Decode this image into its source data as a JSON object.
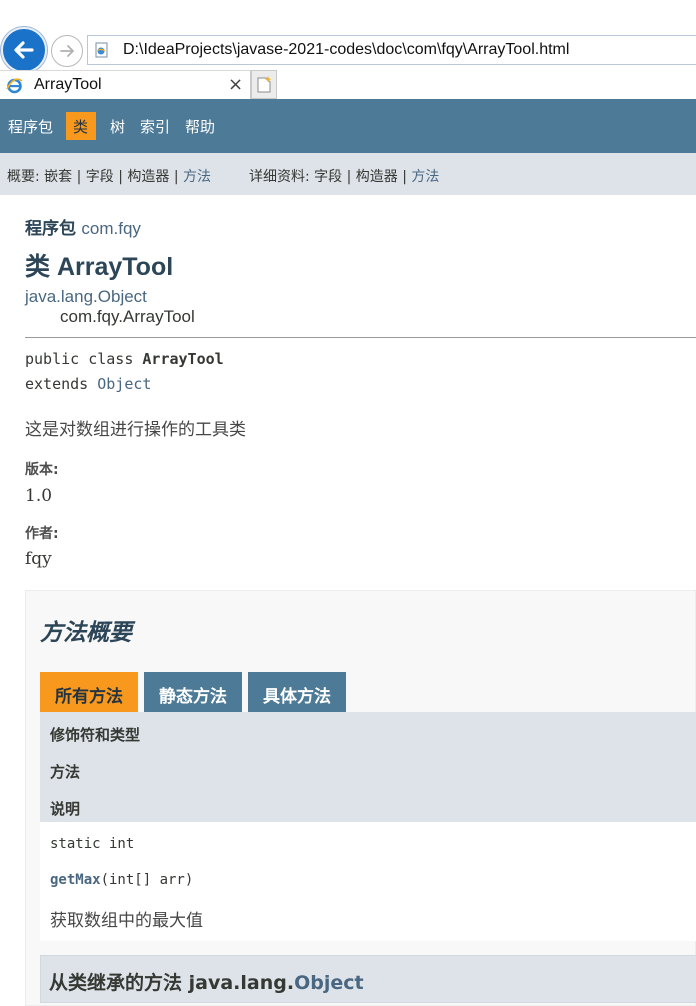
{
  "browser": {
    "address": "D:\\IdeaProjects\\javase-2021-codes\\doc\\com\\fqy\\ArrayTool.html",
    "tab_title": "ArrayTool",
    "tab_close": "×"
  },
  "top_nav": {
    "items": [
      "程序包",
      "类",
      "树",
      "索引",
      "帮助"
    ],
    "current": "类"
  },
  "sub_nav": {
    "summary_prefix": "概要: 嵌套 | 字段 | 构造器 | ",
    "summary_link": "方法",
    "detail_prefix": "详细资料: 字段 | 构造器 | ",
    "detail_link": "方法"
  },
  "header": {
    "package_label": "程序包",
    "package_name": "com.fqy",
    "class_title": "类 ArrayTool",
    "inherit_parent": "java.lang.Object",
    "inherit_child": "com.fqy.ArrayTool"
  },
  "signature": {
    "line1_prefix": "public class ",
    "line1_name": "ArrayTool",
    "line2_prefix": "extends ",
    "line2_link": "Object"
  },
  "description": "这是对数组进行操作的工具类",
  "tags": {
    "version_label": "版本:",
    "version_value": "1.0",
    "author_label": "作者:",
    "author_value": "fqy"
  },
  "method_summary": {
    "title": "方法概要",
    "tabs": [
      "所有方法",
      "静态方法",
      "具体方法"
    ],
    "active_tab": "所有方法",
    "headers": [
      "修饰符和类型",
      "方法",
      "说明"
    ],
    "rows": [
      {
        "modifier": "static int",
        "method_name": "getMax",
        "method_params": "(int[] arr)",
        "description": "获取数组中的最大值"
      }
    ],
    "inherited_prefix": "从类继承的方法 java.lang.",
    "inherited_link": "Object"
  },
  "colors": {
    "nav_bg": "#4d7a97",
    "accent": "#f8981d",
    "subnav_bg": "#dee3e9",
    "link": "#4a6782"
  }
}
